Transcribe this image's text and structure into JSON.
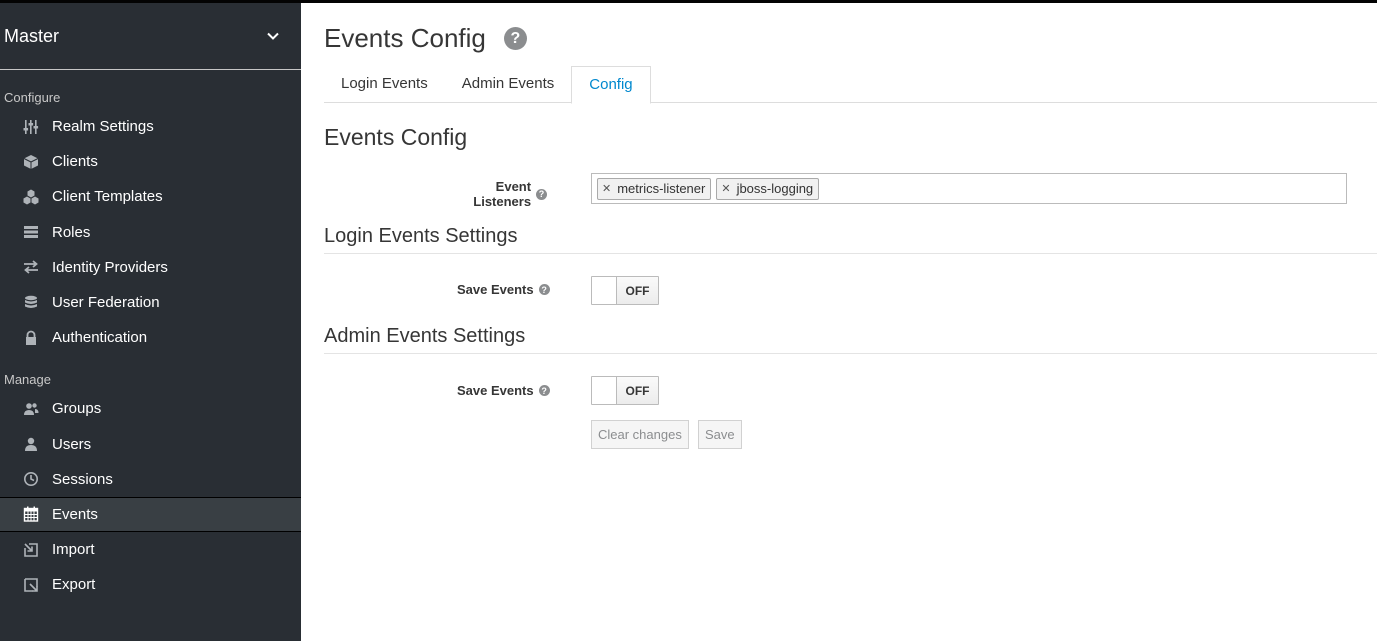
{
  "sidebar": {
    "realm": "Master",
    "configure_label": "Configure",
    "manage_label": "Manage",
    "configure_items": [
      {
        "label": "Realm Settings",
        "icon": "sliders-icon"
      },
      {
        "label": "Clients",
        "icon": "cube-icon"
      },
      {
        "label": "Client Templates",
        "icon": "cubes-icon"
      },
      {
        "label": "Roles",
        "icon": "list-icon"
      },
      {
        "label": "Identity Providers",
        "icon": "exchange-icon"
      },
      {
        "label": "User Federation",
        "icon": "database-icon"
      },
      {
        "label": "Authentication",
        "icon": "lock-icon"
      }
    ],
    "manage_items": [
      {
        "label": "Groups",
        "icon": "users-icon"
      },
      {
        "label": "Users",
        "icon": "user-icon"
      },
      {
        "label": "Sessions",
        "icon": "clock-icon"
      },
      {
        "label": "Events",
        "icon": "calendar-icon",
        "active": true
      },
      {
        "label": "Import",
        "icon": "import-icon"
      },
      {
        "label": "Export",
        "icon": "export-icon"
      }
    ]
  },
  "page": {
    "title": "Events Config",
    "tabs": [
      {
        "label": "Login Events"
      },
      {
        "label": "Admin Events"
      },
      {
        "label": "Config",
        "active": true
      }
    ],
    "section_title": "Events Config",
    "event_listeners_label": "Event Listeners",
    "event_listeners": [
      "metrics-listener",
      "jboss-logging"
    ],
    "login_settings_title": "Login Events Settings",
    "admin_settings_title": "Admin Events Settings",
    "save_events_label": "Save Events",
    "login_save_events_state": "OFF",
    "admin_save_events_state": "OFF",
    "clear_changes_label": "Clear changes",
    "save_label": "Save"
  },
  "colors": {
    "sidebar_bg": "#292e34",
    "active_tab": "#0088ce"
  }
}
